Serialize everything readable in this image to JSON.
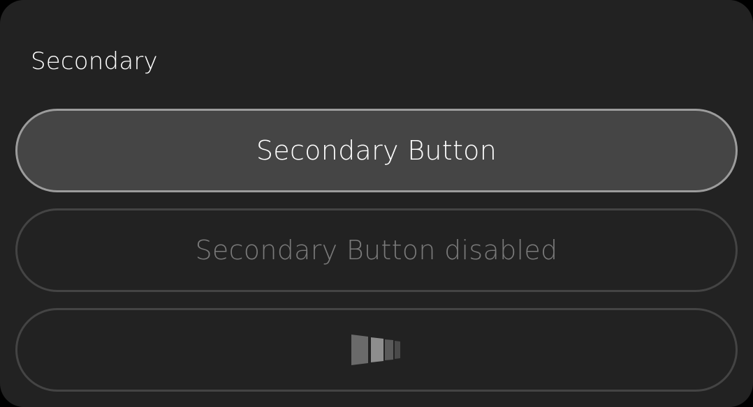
{
  "section": {
    "title": "Secondary"
  },
  "buttons": {
    "active_label": "Secondary Button",
    "disabled_label": "Secondary Button disabled",
    "loading_icon": "loading-bars-icon"
  },
  "colors": {
    "card_background": "#222222",
    "button_fill": "#454545",
    "button_border": "#9c9c9c",
    "disabled_border": "#444444",
    "disabled_text": "#7a7a7a"
  }
}
